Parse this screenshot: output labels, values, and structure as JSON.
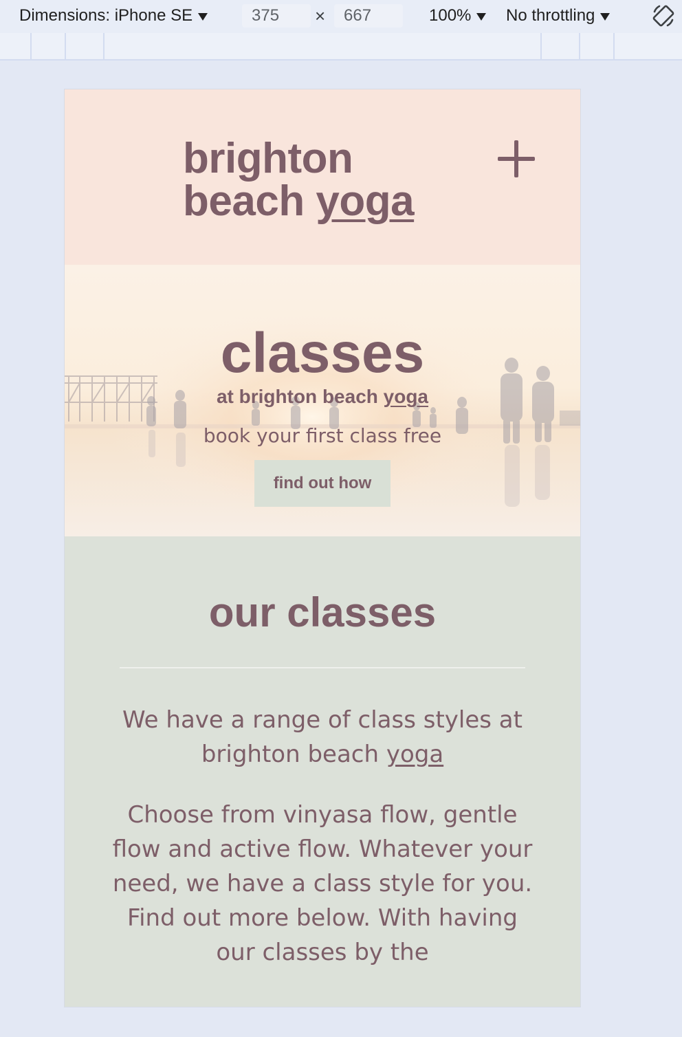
{
  "devtools": {
    "dimensions_label": "Dimensions: iPhone SE",
    "width_value": "375",
    "times_sign": "×",
    "height_value": "667",
    "zoom": "100%",
    "throttling": "No throttling"
  },
  "header": {
    "logo_line1": "brighton",
    "logo_line2_a": "beach ",
    "logo_line2_b": "yoga"
  },
  "hero": {
    "title": "classes",
    "subtitle_a": "at brighton beach ",
    "subtitle_b": "yoga",
    "tagline": "book your first class free",
    "button_label": "find out how"
  },
  "classes": {
    "title": "our classes",
    "p1_a": "We have a range of class styles at brighton beach ",
    "p1_b": "yoga",
    "p2": "Choose from vinyasa flow, gentle flow and active flow. Whatever your need, we have a class style for you. Find out more below. With having our classes by the"
  },
  "colors": {
    "brand": "#7d5e68",
    "header_bg": "#f9e5dc",
    "section_bg": "#dce1d9",
    "button_bg": "#d9e0d6"
  }
}
